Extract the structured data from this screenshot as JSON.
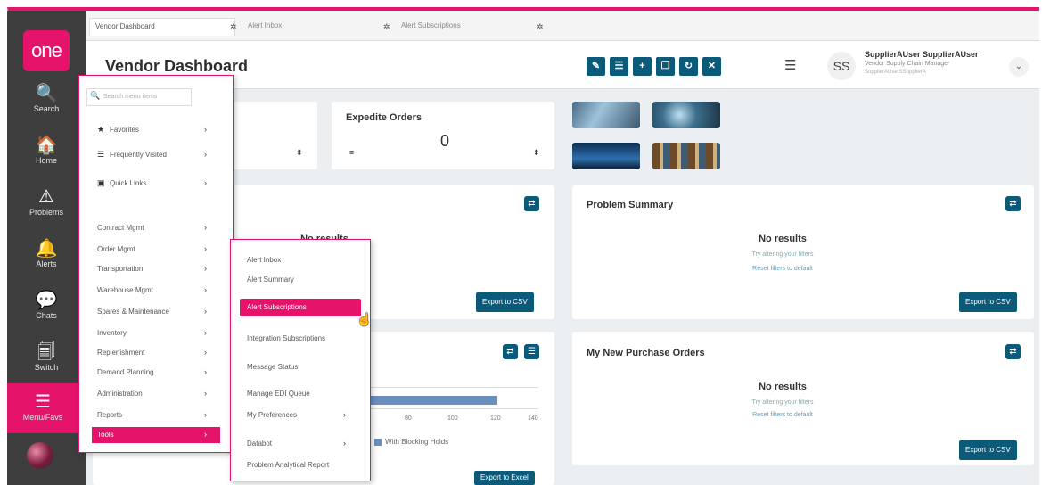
{
  "tabs": [
    {
      "label": "Vendor Dashboard"
    },
    {
      "label": "Alert Inbox"
    },
    {
      "label": "Alert Subscriptions"
    }
  ],
  "rail": {
    "logo": "one",
    "items": [
      {
        "icon": "🔍",
        "label": "Search"
      },
      {
        "icon": "🏠",
        "label": "Home"
      },
      {
        "icon": "⚠",
        "label": "Problems"
      },
      {
        "icon": "🔔",
        "label": "Alerts"
      },
      {
        "icon": "💬",
        "label": "Chats"
      },
      {
        "icon": "🗐",
        "label": "Switch"
      }
    ],
    "menu": {
      "icon": "☰",
      "label": "Menu/Favs"
    }
  },
  "header": {
    "title": "Vendor Dashboard",
    "toolbar_icons": [
      "✎",
      "☷",
      "+",
      "❐",
      "↻",
      "✕"
    ],
    "hamburger": "☰",
    "avatar": "SS",
    "user_name": "SupplierAUser SupplierAUser",
    "user_role": "Vendor Supply Chain Manager",
    "user_email": "SupplierAUserSSupplierA",
    "chevron": "⌄"
  },
  "cards": {
    "expedite": {
      "title": "Expedite Orders",
      "value": "0"
    },
    "problem_summary": {
      "title": "Problem Summary",
      "no_results": "No results",
      "hint": "Try altering your filters",
      "reset": "Reset filters to default",
      "export": "Export to CSV"
    },
    "left_middle": {
      "no_results": "No results",
      "export": "Export to CSV"
    },
    "new_po": {
      "title": "My New Purchase Orders",
      "no_results": "No results",
      "hint": "Try altering your filters",
      "reset": "Reset filters to default",
      "export": "Export to CSV"
    },
    "chart": {
      "ticks": [
        "80",
        "100",
        "120",
        "140"
      ],
      "legend": "With Blocking Holds",
      "export": "Export to Excel"
    }
  },
  "menu1": {
    "search_placeholder": "Search menu items",
    "items": [
      {
        "icon": "★",
        "label": "Favorites"
      },
      {
        "icon": "☰",
        "label": "Frequently Visited"
      },
      {
        "icon": "▣",
        "label": "Quick Links"
      },
      {
        "label": "Contract Mgmt"
      },
      {
        "label": "Order Mgmt"
      },
      {
        "label": "Transportation"
      },
      {
        "label": "Warehouse Mgmt"
      },
      {
        "label": "Spares & Maintenance"
      },
      {
        "label": "Inventory"
      },
      {
        "label": "Replenishment"
      },
      {
        "label": "Demand Planning"
      },
      {
        "label": "Administration"
      },
      {
        "label": "Reports"
      },
      {
        "label": "Tools"
      }
    ]
  },
  "menu2": {
    "items": [
      {
        "label": "Alert Inbox"
      },
      {
        "label": "Alert Summary"
      },
      {
        "label": "Alert Subscriptions"
      },
      {
        "label": "Integration Subscriptions"
      },
      {
        "label": "Message Status"
      },
      {
        "label": "Manage EDI Queue"
      },
      {
        "label": "My Preferences"
      },
      {
        "label": "Databot"
      },
      {
        "label": "Problem Analytical Report"
      }
    ]
  },
  "colors": {
    "accent": "#e6136b",
    "primary": "#0c5a7a",
    "rail": "#3e3e3e"
  }
}
